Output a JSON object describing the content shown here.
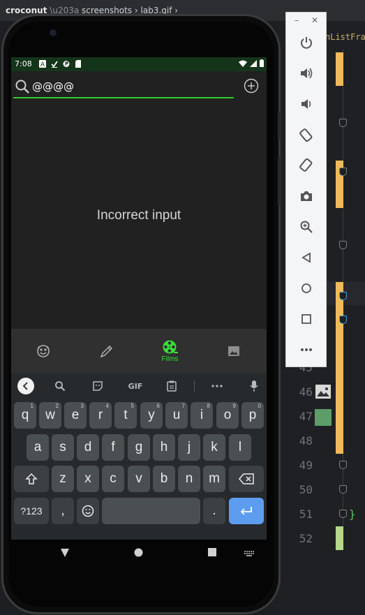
{
  "ide": {
    "breadcrumb_project": "croconut",
    "breadcrumb_rest": "screenshots  ›  lab3.gif  ›",
    "class_name": "nListFragm",
    "line_numbers": [
      "45",
      "46",
      "47",
      "48",
      "49",
      "50",
      "51",
      "52"
    ],
    "closing_brace": "}"
  },
  "emulator_toolbar": {
    "minimize": "–",
    "close": "✕",
    "buttons": [
      "power-icon",
      "volume-up-icon",
      "volume-down-icon",
      "rotate-left-icon",
      "rotate-right-icon",
      "camera-icon",
      "zoom-icon",
      "back-icon",
      "home-icon",
      "overview-icon",
      "more-icon"
    ]
  },
  "status_bar": {
    "time": "7:08"
  },
  "search": {
    "value": "@@@@"
  },
  "main": {
    "message": "Incorrect input"
  },
  "bottom_nav": {
    "items": [
      {
        "icon": "smiley-icon",
        "label": ""
      },
      {
        "icon": "pencil-icon",
        "label": ""
      },
      {
        "icon": "film-reel-icon",
        "label": "Films"
      },
      {
        "icon": "image-icon",
        "label": ""
      }
    ],
    "active_color": "#38e038"
  },
  "keyboard": {
    "toolbar": {
      "gif": "GIF"
    },
    "row1": [
      {
        "key": "q",
        "hint": "1"
      },
      {
        "key": "w",
        "hint": "2"
      },
      {
        "key": "e",
        "hint": "3"
      },
      {
        "key": "r",
        "hint": "4"
      },
      {
        "key": "t",
        "hint": "5"
      },
      {
        "key": "y",
        "hint": "6"
      },
      {
        "key": "u",
        "hint": "7"
      },
      {
        "key": "i",
        "hint": "8"
      },
      {
        "key": "o",
        "hint": "9"
      },
      {
        "key": "p",
        "hint": "0"
      }
    ],
    "row2": [
      "a",
      "s",
      "d",
      "f",
      "g",
      "h",
      "j",
      "k",
      "l"
    ],
    "row3": [
      "z",
      "x",
      "c",
      "v",
      "b",
      "n",
      "m"
    ],
    "row4": {
      "symbols": "?123",
      "comma": ",",
      "period": "."
    }
  }
}
